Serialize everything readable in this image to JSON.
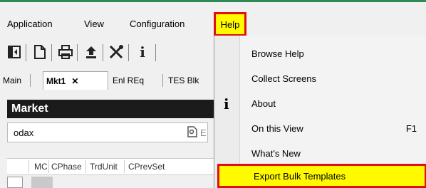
{
  "menubar": {
    "items": [
      "Application",
      "View",
      "Configuration"
    ],
    "help_label": "Help"
  },
  "toolbar": {
    "icons": [
      "panel-toggle-icon",
      "new-document-icon",
      "print-icon",
      "upload-icon",
      "tools-icon",
      "info-icon"
    ]
  },
  "tabs": {
    "items": [
      {
        "label": "Main"
      },
      {
        "label": "Mkt1",
        "close": "✕",
        "active": true
      },
      {
        "label": "Enl REq"
      },
      {
        "label": "TES Blk"
      }
    ]
  },
  "market_panel": {
    "title": "Market",
    "search_value": "odax",
    "search_button_partial": "E"
  },
  "grid": {
    "columns": [
      "MC",
      "CPhase",
      "TrdUnit",
      "CPrevSet"
    ]
  },
  "help_menu": {
    "items": [
      {
        "label": "Browse Help"
      },
      {
        "label": "Collect Screens"
      },
      {
        "label": "About"
      },
      {
        "label": "On this View",
        "shortcut": "F1"
      },
      {
        "label": "What's New"
      },
      {
        "label": "Export Bulk Templates",
        "highlighted": true
      }
    ]
  },
  "colors": {
    "accent_green": "#2e8b57",
    "highlight_yellow": "#fffa00",
    "highlight_border_red": "#e01010",
    "panel_header_bg": "#1b1b1b"
  }
}
